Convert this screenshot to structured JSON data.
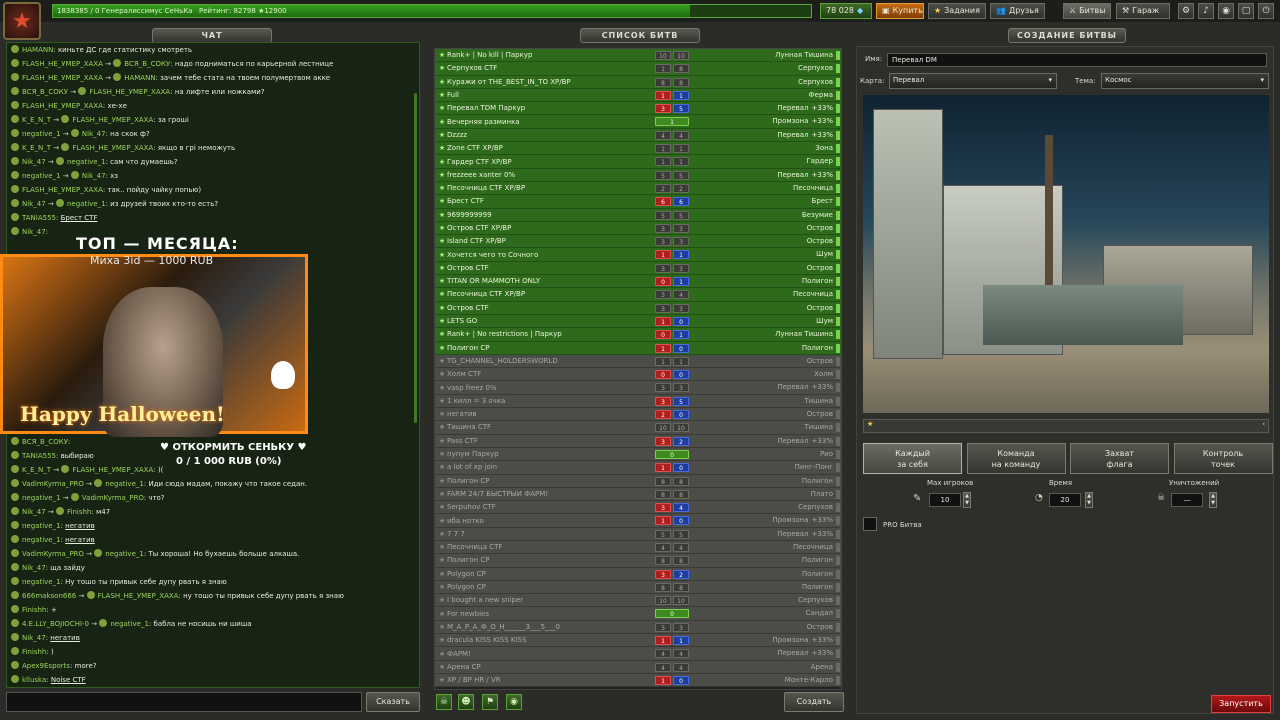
{
  "top": {
    "rank_text": "1838385 / 0 Генералиссимус СеНьКа",
    "rating": "Рейтинг: 82798",
    "score": "12900",
    "crystals": "78 028",
    "buy": "Купить",
    "tasks": "Задания",
    "friends": "Друзья",
    "battles": "Битвы",
    "garage": "Гараж",
    "colors": {
      "accent_green": "#2e6a1c",
      "rank_fill": "#36a11e",
      "buy_orange": "#c56a10",
      "start_red": "#b41818"
    }
  },
  "chat": {
    "title": "ЧАТ",
    "send": "Сказать",
    "overlay": {
      "title": "ТОП — МЕСЯЦА:",
      "subtitle": "Миха 3id — 1000 RUB",
      "banner": "Happy Halloween!",
      "donate_line1": "♥ ОТКОРМИТЬ СЕНЬКУ ♥",
      "donate_line2": "0 / 1 000 RUB (0%)"
    },
    "lines": [
      {
        "from": "HAMANN",
        "text": "киньте ДС где статистику смотреть"
      },
      {
        "from": "FLASH_HE_УМЕР_ХАХА",
        "to": "ВСЯ_В_СОКУ",
        "text": "надо подниматься по карьерной лестнице"
      },
      {
        "from": "FLASH_HE_УМЕР_ХАХА",
        "to": "HAMANN",
        "text": "зачем тебе стата на твоем полумертвом акке"
      },
      {
        "from": "ВСЯ_В_СОКУ",
        "to": "FLASH_HE_УМЕР_ХАХА",
        "text": "на лифте или ножками?"
      },
      {
        "from": "FLASH_HE_УМЕР_ХАХА",
        "text": "хе-хе"
      },
      {
        "from": "K_E_N_T",
        "to": "FLASH_HE_УМЕР_ХАХА",
        "text": "за гроші"
      },
      {
        "from": "negative_1",
        "to": "Nik_47",
        "text": "на скок ф?"
      },
      {
        "from": "K_E_N_T",
        "to": "FLASH_HE_УМЕР_ХАХА",
        "text": "якщо в грі неможуть"
      },
      {
        "from": "Nik_47",
        "to": "negative_1",
        "text": "сам что думаешь?"
      },
      {
        "from": "negative_1",
        "to": "Nik_47",
        "text": "хз"
      },
      {
        "from": "FLASH_HE_УМЕР_ХАХА",
        "text": "так.. пойду чайку попью)"
      },
      {
        "from": "Nik_47",
        "to": "negative_1",
        "text": "из друзей твоих кто-то есть?"
      },
      {
        "from": "TANIA555",
        "link": "Брест CTF"
      },
      {
        "from": "Nik_47",
        "text": ""
      },
      {
        "from": "",
        "text": ""
      },
      {
        "from": "",
        "text": ""
      },
      {
        "from": "",
        "text": ""
      },
      {
        "from": "",
        "text": ""
      },
      {
        "from": "",
        "text": ""
      },
      {
        "from": "",
        "text": ""
      },
      {
        "from": "",
        "text": ""
      },
      {
        "from": "",
        "text": ""
      },
      {
        "from": "",
        "text": ""
      },
      {
        "from": "",
        "text": ""
      },
      {
        "from": "",
        "text": ""
      },
      {
        "from": "",
        "text": ""
      },
      {
        "from": "",
        "text": ""
      },
      {
        "from": "",
        "text": ""
      },
      {
        "from": "ВСЯ_В_СОКУ",
        "text": ""
      },
      {
        "from": "TANIA555",
        "text": "выбираю"
      },
      {
        "from": "K_E_N_T",
        "to": "FLASH_HE_УМЕР_ХАХА",
        "text": ")("
      },
      {
        "from": "VadimKyrma_PRO",
        "to": "negative_1",
        "text": "Иди сюда мадам, покажу что такое седан."
      },
      {
        "from": "negative_1",
        "to": "VadimKyrma_PRO",
        "text": "что?"
      },
      {
        "from": "Nik_47",
        "to": "Finishh",
        "text": "м47"
      },
      {
        "from": "negative_1",
        "link": "негатив"
      },
      {
        "from": "negative_1",
        "link": "негатив"
      },
      {
        "from": "VadimKyrma_PRO",
        "to": "negative_1",
        "text": "Ты хороша! Но бухаешь больше алкаша."
      },
      {
        "from": "Nik_47",
        "text": "ща зайду"
      },
      {
        "from": "negative_1",
        "text": "Ну тошо ты привык себе дупу рвать я знаю"
      },
      {
        "from": "666makson666",
        "to": "FLASH_HE_УМЕР_ХАХА",
        "text": "ну тошо ты привык себе дупу рвать я знаю"
      },
      {
        "from": "Finishh",
        "text": "+"
      },
      {
        "from": "4.E.LLY_BOJIOCHI-0",
        "to": "negative_1",
        "text": "бабла не носишь ни шиша"
      },
      {
        "from": "Nik_47",
        "link": "негатив"
      },
      {
        "from": "Finishh",
        "text": ")"
      },
      {
        "from": "Apex9Esports",
        "text": "more?"
      },
      {
        "from": "klluska",
        "link": "Noise CTF"
      }
    ]
  },
  "battles": {
    "title": "СПИСОК БИТВ",
    "create": "Создать",
    "rows": [
      {
        "a": true,
        "name": "Rank+ | No kill | Паркур",
        "pl": "2",
        "sc": [
          "10",
          "10"
        ],
        "mode": "w",
        "map": "Лунная Тишина"
      },
      {
        "a": true,
        "name": "Серпухов CTF",
        "pl": "1",
        "sc": [
          "1",
          "8"
        ],
        "mode": "g",
        "map": "Серпухов"
      },
      {
        "a": true,
        "name": "Куражи от THE_BEST_IN_TO XP/BP",
        "pl": "1",
        "sc": [
          "8",
          "8"
        ],
        "mode": "g",
        "map": "Серпухов"
      },
      {
        "a": true,
        "name": "Full",
        "pl": "",
        "sc": [
          "1",
          "1"
        ],
        "mode": "rb",
        "map": "Ферма"
      },
      {
        "a": true,
        "name": "Перевал TDM Паркур",
        "pl": "",
        "sc": [
          "3",
          "5"
        ],
        "mode": "rb",
        "map": "Перевал",
        "pro": "+33%"
      },
      {
        "a": true,
        "name": "Вечерняя разминка",
        "pl": "",
        "sc": [
          "1"
        ],
        "mode": "dm",
        "map": "Промзона",
        "pro": "+33%"
      },
      {
        "a": true,
        "name": "Dzzzz",
        "pl": "",
        "sc": [
          "4",
          "4"
        ],
        "mode": "g",
        "map": "Перевал",
        "pro": "+33%"
      },
      {
        "a": true,
        "name": "Zone CTF XP/BP",
        "pl": "",
        "sc": [
          "1",
          "1"
        ],
        "mode": "g",
        "map": "Зона"
      },
      {
        "a": true,
        "name": "Гардер CTF XP/BP",
        "pl": "",
        "sc": [
          "1",
          "1"
        ],
        "mode": "g",
        "map": "Гардер"
      },
      {
        "a": true,
        "name": "frezzeee xanter 0%",
        "pl": "",
        "sc": [
          "5",
          "5"
        ],
        "mode": "g",
        "map": "Перевал",
        "pro": "+33%"
      },
      {
        "a": true,
        "name": "Песочница CTF XP/BP",
        "pl": "",
        "sc": [
          "2",
          "2"
        ],
        "mode": "g",
        "map": "Песочница"
      },
      {
        "a": true,
        "name": "Брест CTF",
        "pl": "",
        "sc": [
          "6",
          "6"
        ],
        "mode": "rb",
        "map": "Брест"
      },
      {
        "a": true,
        "name": "9699999999",
        "pl": "",
        "sc": [
          "5",
          "5"
        ],
        "mode": "g",
        "map": "Безумие"
      },
      {
        "a": true,
        "name": "Остров CTF XP/BP",
        "pl": "",
        "sc": [
          "3",
          "3"
        ],
        "mode": "g",
        "map": "Остров"
      },
      {
        "a": true,
        "name": "Island CTF XP/BP",
        "pl": "",
        "sc": [
          "3",
          "3"
        ],
        "mode": "g",
        "map": "Остров"
      },
      {
        "a": true,
        "name": "Хочется чего то Сочного",
        "pl": "",
        "sc": [
          "1",
          "1"
        ],
        "mode": "rb",
        "map": "Шум"
      },
      {
        "a": true,
        "name": "Остров CTF",
        "pl": "",
        "sc": [
          "3",
          "3"
        ],
        "mode": "g",
        "map": "Остров"
      },
      {
        "a": true,
        "name": "TITAN OR MAMMOTH ONLY",
        "pl": "",
        "sc": [
          "0",
          "1"
        ],
        "mode": "rb",
        "map": "Полигон"
      },
      {
        "a": true,
        "name": "Песочница CTF XP/BP",
        "pl": "",
        "sc": [
          "3",
          "4"
        ],
        "mode": "g",
        "map": "Песочница"
      },
      {
        "a": true,
        "name": "Остров CTF",
        "pl": "",
        "sc": [
          "3",
          "3"
        ],
        "mode": "g",
        "map": "Остров"
      },
      {
        "a": true,
        "name": "LETS GO",
        "pl": "",
        "sc": [
          "1",
          "0"
        ],
        "mode": "rb",
        "map": "Шум"
      },
      {
        "a": true,
        "name": "Rank+ | No restrictions | Паркур",
        "pl": "",
        "sc": [
          "0",
          "1"
        ],
        "mode": "rb",
        "map": "Лунная Тишина"
      },
      {
        "a": true,
        "name": "Полигон CP",
        "pl": "",
        "sc": [
          "1",
          "0"
        ],
        "mode": "rb",
        "map": "Полигон"
      },
      {
        "a": false,
        "name": "TG_CHANNEL_HOLDERSWORLD",
        "pl": "1",
        "sc": [
          "1",
          "1"
        ],
        "mode": "g",
        "map": "Остров"
      },
      {
        "a": false,
        "name": "Холм CTF",
        "pl": "",
        "sc": [
          "0",
          "0"
        ],
        "mode": "rb",
        "map": "Холм"
      },
      {
        "a": false,
        "name": "vasp freez 0%",
        "pl": "",
        "sc": [
          "3",
          "3"
        ],
        "mode": "g",
        "map": "Перевал",
        "pro": "+33%"
      },
      {
        "a": false,
        "name": "1 килл = 3 очка",
        "pl": "",
        "sc": [
          "3",
          "5"
        ],
        "mode": "rb",
        "map": "Тишина"
      },
      {
        "a": false,
        "name": "негатив",
        "pl": "",
        "sc": [
          "2",
          "0"
        ],
        "mode": "rb",
        "map": "Остров"
      },
      {
        "a": false,
        "name": "Тишина CTF",
        "pl": "",
        "sc": [
          "10",
          "10"
        ],
        "mode": "g",
        "map": "Тишина"
      },
      {
        "a": false,
        "name": "Pass CTF",
        "pl": "",
        "sc": [
          "3",
          "2"
        ],
        "mode": "rb",
        "map": "Перевал",
        "pro": "+33%"
      },
      {
        "a": false,
        "name": "пупум Паркур",
        "pl": "",
        "sc": [
          "0"
        ],
        "mode": "dm",
        "map": "Рио"
      },
      {
        "a": false,
        "name": "a lot of xp join",
        "pl": "",
        "sc": [
          "1",
          "0"
        ],
        "mode": "rb",
        "map": "Пинг-Понг"
      },
      {
        "a": false,
        "name": "Полигон CP",
        "pl": "",
        "sc": [
          "8",
          "8"
        ],
        "mode": "g",
        "map": "Полигон"
      },
      {
        "a": false,
        "name": "FARM 24/7 БЫСТРЫЙ ФАРМ!",
        "pl": "",
        "sc": [
          "8",
          "8"
        ],
        "mode": "g",
        "map": "Плато"
      },
      {
        "a": false,
        "name": "Serpuhov CTF",
        "pl": "",
        "sc": [
          "3",
          "4"
        ],
        "mode": "rb",
        "map": "Серпухов"
      },
      {
        "a": false,
        "name": "ибa нотко",
        "pl": "",
        "sc": [
          "1",
          "0"
        ],
        "mode": "rb",
        "map": "Промзона",
        "pro": "+33%"
      },
      {
        "a": false,
        "name": "7 7 7",
        "pl": "",
        "sc": [
          "5",
          "5"
        ],
        "mode": "g",
        "map": "Перевал",
        "pro": "+33%"
      },
      {
        "a": false,
        "name": "Песочница CTF",
        "pl": "",
        "sc": [
          "4",
          "4"
        ],
        "mode": "g",
        "map": "Песочница"
      },
      {
        "a": false,
        "name": "Полигон CP",
        "pl": "",
        "sc": [
          "8",
          "8"
        ],
        "mode": "g",
        "map": "Полигон"
      },
      {
        "a": false,
        "name": "Polygon CP",
        "pl": "",
        "sc": [
          "3",
          "2"
        ],
        "mode": "rb",
        "map": "Полигон"
      },
      {
        "a": false,
        "name": "Polygon CP",
        "pl": "",
        "sc": [
          "8",
          "8"
        ],
        "mode": "g",
        "map": "Полигон"
      },
      {
        "a": false,
        "name": "I bought a new sniper",
        "pl": "",
        "sc": [
          "10",
          "10"
        ],
        "mode": "g",
        "map": "Серпухов"
      },
      {
        "a": false,
        "name": "For newbies",
        "pl": "",
        "sc": [
          "0"
        ],
        "mode": "dm",
        "map": "Сандал"
      },
      {
        "a": false,
        "name": "M_A_P_A_Ф_О_Н______3___5___0",
        "pl": "",
        "sc": [
          "3",
          "3"
        ],
        "mode": "g",
        "map": "Остров"
      },
      {
        "a": false,
        "name": "dracula KISS KISS KISS",
        "pl": "",
        "sc": [
          "1",
          "1"
        ],
        "mode": "rb",
        "map": "Промзона",
        "pro": "+33%"
      },
      {
        "a": false,
        "name": "ФАРМ!",
        "pl": "",
        "sc": [
          "4",
          "4"
        ],
        "mode": "g",
        "map": "Перевал",
        "pro": "+33%"
      },
      {
        "a": false,
        "name": "Арена CP",
        "pl": "",
        "sc": [
          "4",
          "4"
        ],
        "mode": "g",
        "map": "Арена"
      },
      {
        "a": false,
        "name": "XP / BP HR / VR",
        "pl": "",
        "sc": [
          "1",
          "0"
        ],
        "mode": "rb",
        "map": "Монте-Карло"
      }
    ]
  },
  "create": {
    "title": "СОЗДАНИЕ БИТВЫ",
    "name_label": "Имя:",
    "name_value": "Перевал DM",
    "map_label": "Карта:",
    "map_value": "Перевал",
    "theme_label": "Тема:",
    "theme_value": "Космос",
    "modes": [
      {
        "l1": "Каждый",
        "l2": "за себя"
      },
      {
        "l1": "Команда",
        "l2": "на команду"
      },
      {
        "l1": "Захват",
        "l2": "флага"
      },
      {
        "l1": "Контроль",
        "l2": "точек"
      }
    ],
    "max_players_label": "Max игроков",
    "max_players": "10",
    "time_label": "Время",
    "time": "20",
    "kills_label": "Уничтожений",
    "kills": "—",
    "pro_label": "PRO Битва",
    "start": "Запустить"
  }
}
